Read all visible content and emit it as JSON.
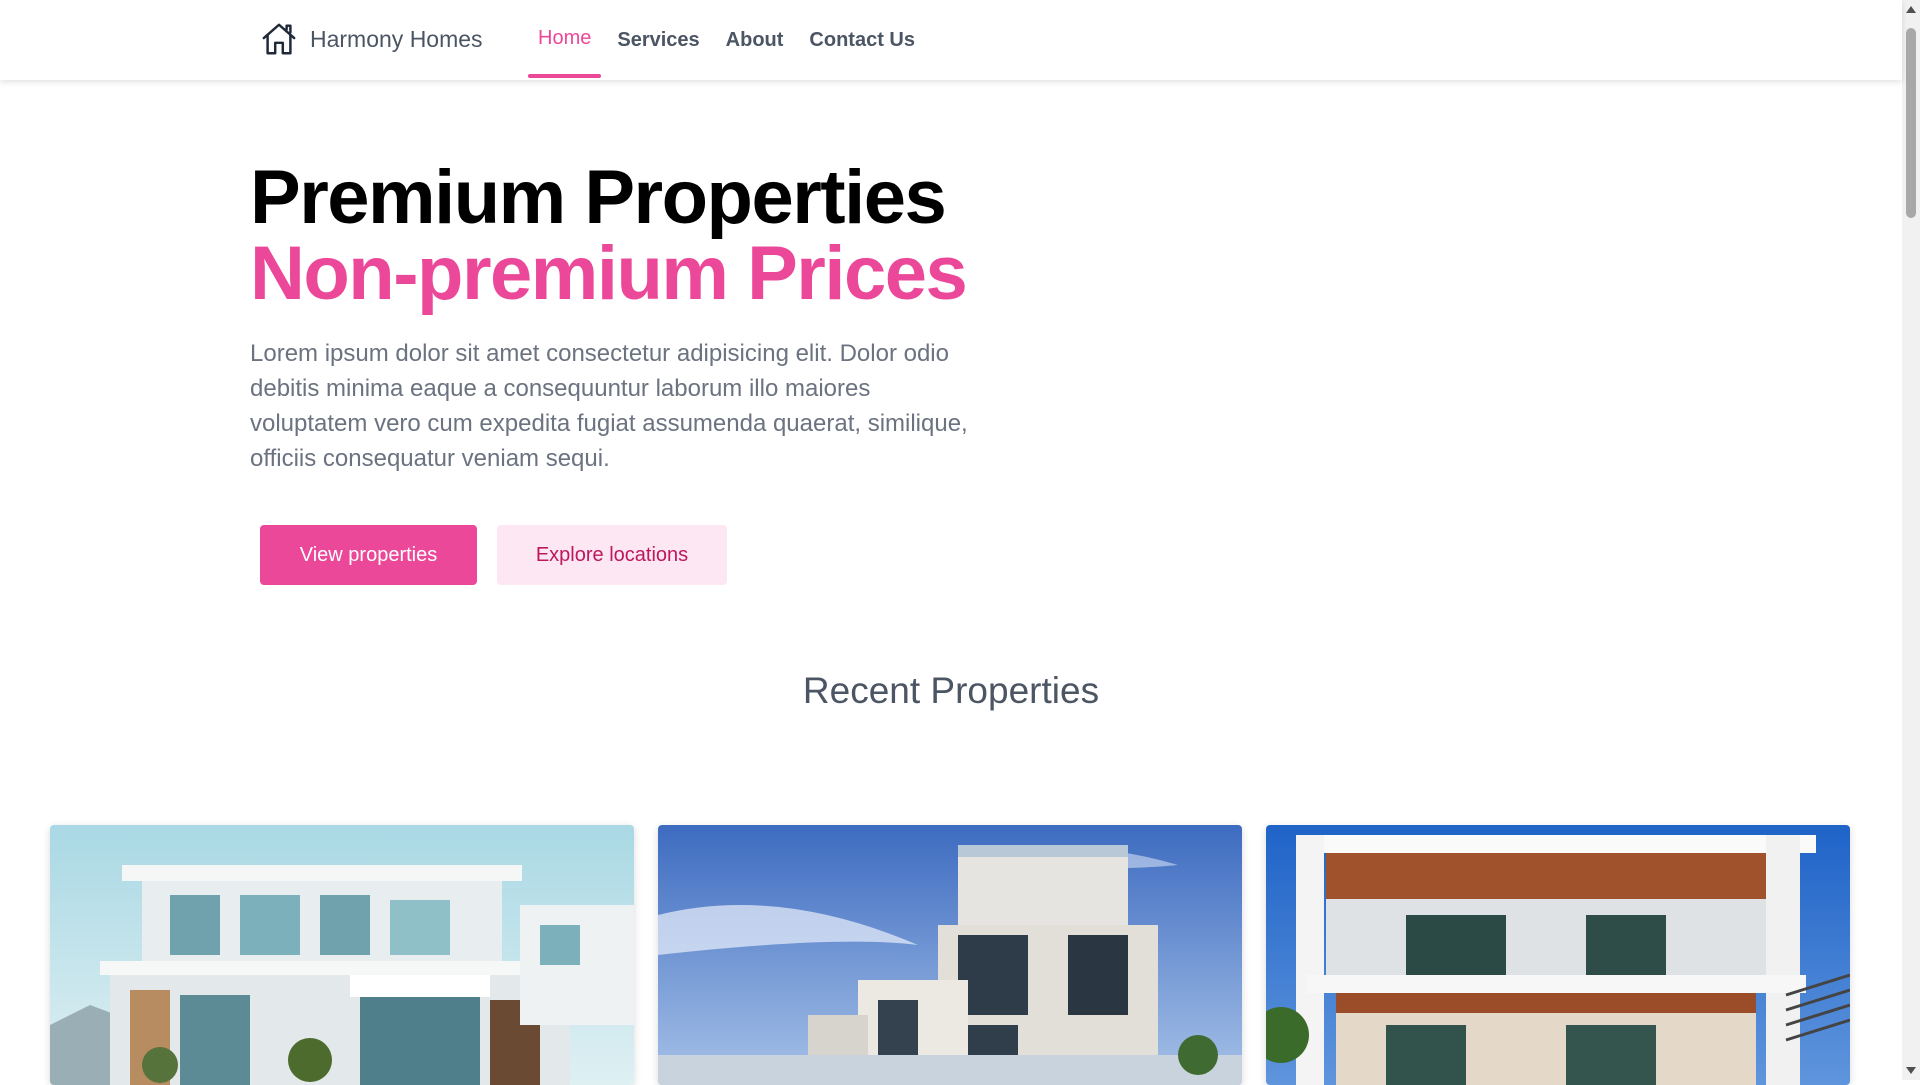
{
  "brand": {
    "name": "Harmony Homes",
    "icon": "house-icon"
  },
  "nav": {
    "items": [
      {
        "label": "Home",
        "active": true
      },
      {
        "label": "Services",
        "active": false
      },
      {
        "label": "About",
        "active": false
      },
      {
        "label": "Contact Us",
        "active": false
      }
    ]
  },
  "hero": {
    "title_line1": "Premium Properties",
    "title_line2": "Non-premium Prices",
    "description": "Lorem ipsum dolor sit amet consectetur adipisicing elit. Dolor odio debitis minima eaque a consequuntur laborum illo maiores voluptatem vero cum expedita fugiat assumenda quaerat, similique, officiis consequatur veniam sequi.",
    "primary_button": "View properties",
    "secondary_button": "Explore locations"
  },
  "recent": {
    "title": "Recent Properties",
    "cards": [
      {
        "image": "modern-white-villa-photo"
      },
      {
        "image": "modern-house-blue-sky-photo"
      },
      {
        "image": "modern-house-wood-ceiling-photo"
      }
    ]
  },
  "colors": {
    "accent": "#ec4899",
    "accent_light": "#fce7f3",
    "text_muted": "#6b7280"
  }
}
